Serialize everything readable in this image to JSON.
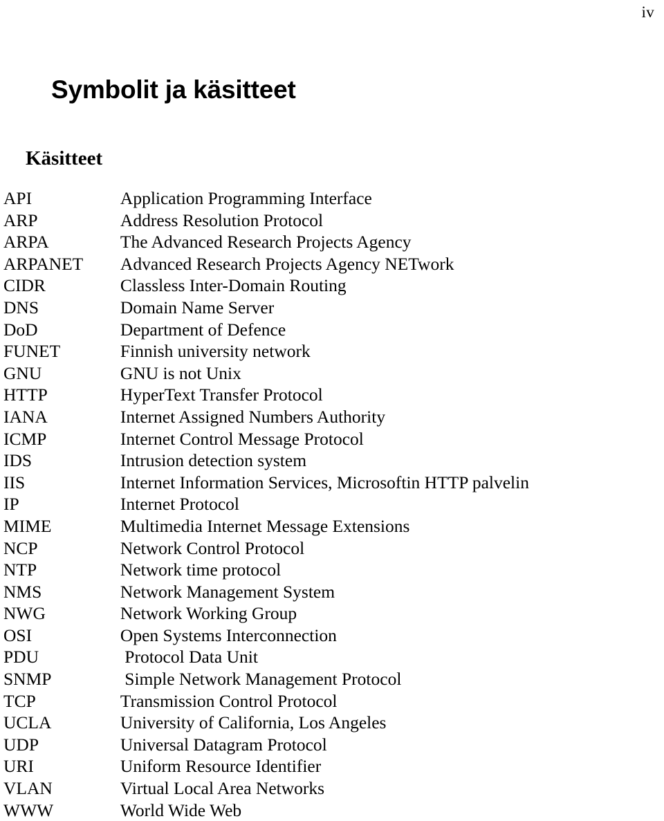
{
  "page": {
    "page_number": "iv",
    "title": "Symbolit ja käsitteet",
    "section_title": "Käsitteet",
    "text_color": "#000000",
    "background_color": "#ffffff"
  },
  "glossary": {
    "entries": [
      {
        "abbr": "API",
        "definition": "Application Programming Interface"
      },
      {
        "abbr": "ARP",
        "definition": "Address Resolution Protocol"
      },
      {
        "abbr": "ARPA",
        "definition": "The Advanced Research Projects Agency"
      },
      {
        "abbr": "ARPANET",
        "definition": "Advanced Research Projects Agency NETwork"
      },
      {
        "abbr": "CIDR",
        "definition": "Classless Inter-Domain Routing"
      },
      {
        "abbr": "DNS",
        "definition": "Domain Name Server"
      },
      {
        "abbr": "DoD",
        "definition": "Department of Defence"
      },
      {
        "abbr": "FUNET",
        "definition": "Finnish university network"
      },
      {
        "abbr": "GNU",
        "definition": "GNU is not Unix"
      },
      {
        "abbr": "HTTP",
        "definition": "HyperText Transfer Protocol"
      },
      {
        "abbr": "IANA",
        "definition": "Internet Assigned Numbers Authority"
      },
      {
        "abbr": "ICMP",
        "definition": "Internet Control Message Protocol"
      },
      {
        "abbr": "IDS",
        "definition": "Intrusion detection system"
      },
      {
        "abbr": "IIS",
        "definition": "Internet Information Services, Microsoftin HTTP palvelin"
      },
      {
        "abbr": "IP",
        "definition": "Internet Protocol"
      },
      {
        "abbr": "MIME",
        "definition": "Multimedia Internet Message Extensions"
      },
      {
        "abbr": "NCP",
        "definition": "Network Control Protocol"
      },
      {
        "abbr": "NTP",
        "definition": "Network time protocol"
      },
      {
        "abbr": "NMS",
        "definition": "Network Management System"
      },
      {
        "abbr": "NWG",
        "definition": "Network Working Group"
      },
      {
        "abbr": "OSI",
        "definition": "Open Systems Interconnection"
      },
      {
        "abbr": "PDU",
        "definition": " Protocol Data Unit"
      },
      {
        "abbr": "SNMP",
        "definition": " Simple Network Management Protocol"
      },
      {
        "abbr": "TCP",
        "definition": "Transmission Control Protocol"
      },
      {
        "abbr": "UCLA",
        "definition": "University of California, Los Angeles"
      },
      {
        "abbr": "UDP",
        "definition": "Universal Datagram Protocol"
      },
      {
        "abbr": "URI",
        "definition": "Uniform Resource Identifier"
      },
      {
        "abbr": "VLAN",
        "definition": "Virtual Local Area Networks"
      },
      {
        "abbr": "WWW",
        "definition": "World Wide Web"
      }
    ]
  }
}
